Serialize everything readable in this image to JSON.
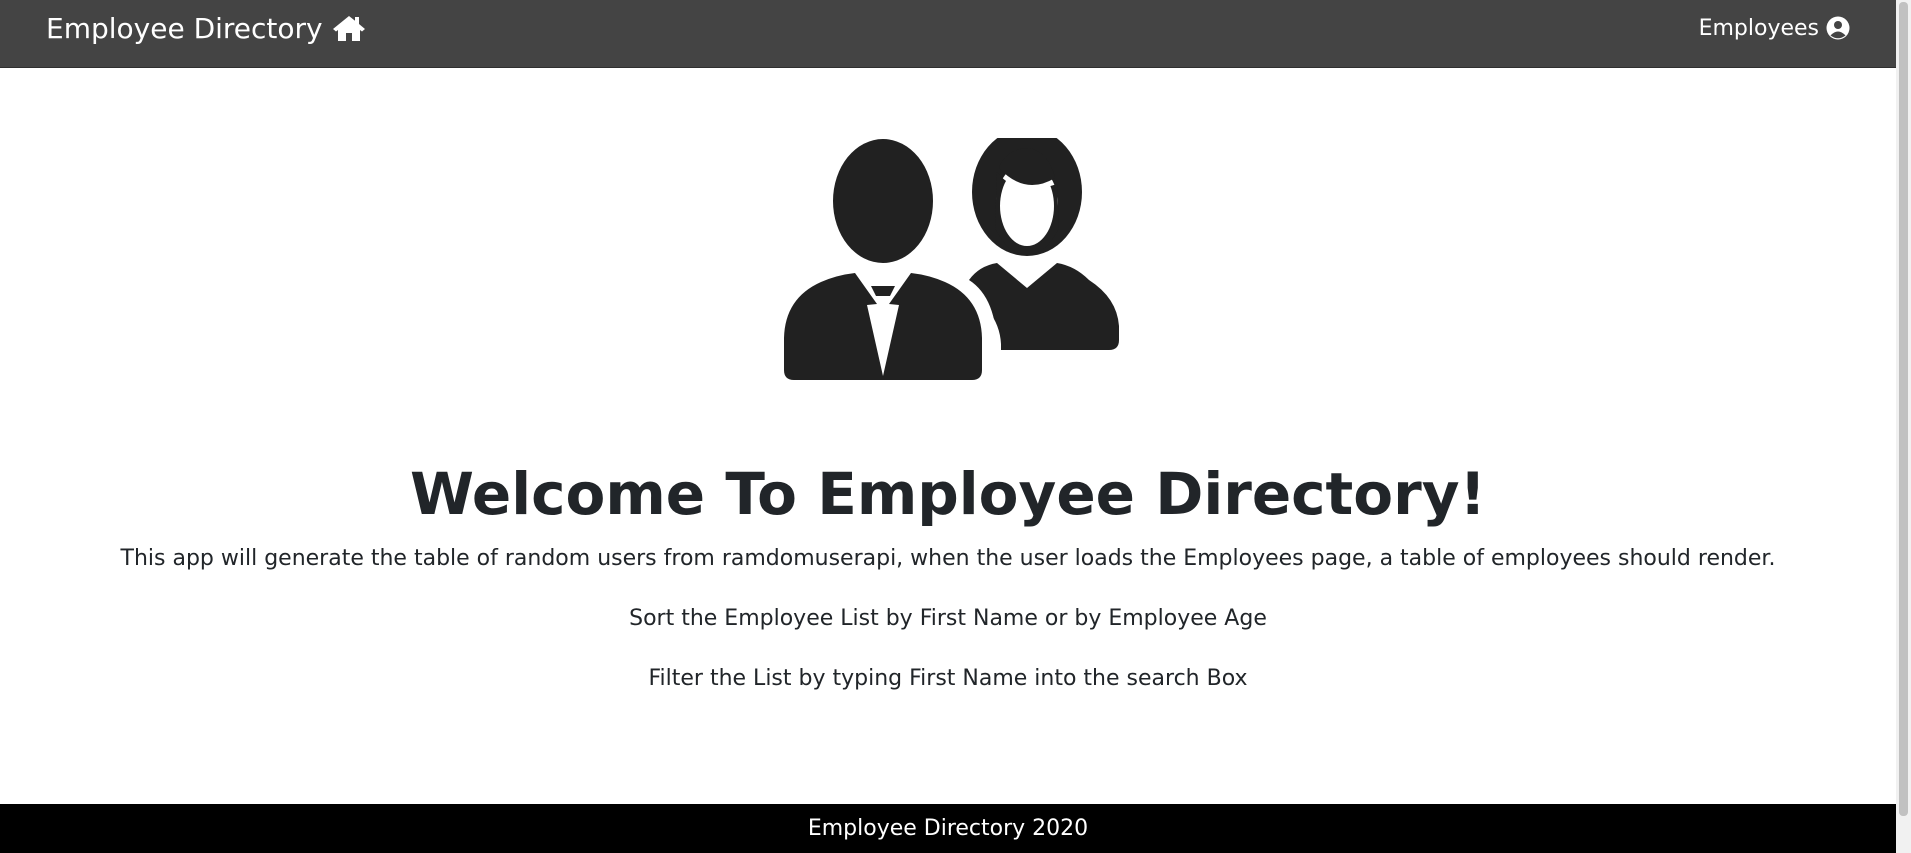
{
  "navbar": {
    "brand_label": "Employee Directory",
    "brand_icon": "home-icon",
    "employees_label": "Employees",
    "employees_icon": "user-circle-icon",
    "background": "#444444"
  },
  "hero": {
    "illustration": "users-icon"
  },
  "main": {
    "title": "Welcome To Employee Directory!",
    "description": "This app will generate the table of random users from ramdomuserapi, when the user loads the Employees page, a table of employees should render.",
    "sort_note": "Sort the Employee List by First Name or by Employee Age",
    "filter_note": "Filter the List by typing First Name into the search Box"
  },
  "footer": {
    "text": "Employee Directory 2020",
    "background": "#000000"
  }
}
